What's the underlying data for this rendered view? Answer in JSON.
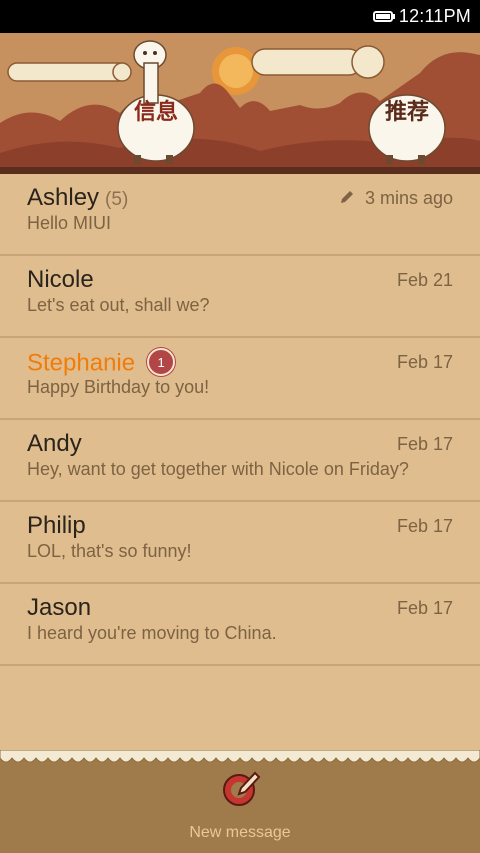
{
  "status_bar": {
    "time": "12:11PM"
  },
  "header": {
    "tab_messages": "信息",
    "tab_recommend": "推荐"
  },
  "conversations": [
    {
      "name": "Ashley",
      "count": "(5)",
      "preview": "Hello MIUI",
      "date": "3 mins ago",
      "draft": true,
      "unread": false,
      "badge": ""
    },
    {
      "name": "Nicole",
      "count": "",
      "preview": "Let's eat out, shall we?",
      "date": "Feb 21",
      "draft": false,
      "unread": false,
      "badge": ""
    },
    {
      "name": "Stephanie",
      "count": "",
      "preview": "Happy Birthday to you!",
      "date": "Feb 17",
      "draft": false,
      "unread": true,
      "badge": "1"
    },
    {
      "name": "Andy",
      "count": "",
      "preview": "Hey, want to get together with Nicole on Friday?",
      "date": "Feb 17",
      "draft": false,
      "unread": false,
      "badge": ""
    },
    {
      "name": "Philip",
      "count": "",
      "preview": "LOL, that's so funny!",
      "date": "Feb 17",
      "draft": false,
      "unread": false,
      "badge": ""
    },
    {
      "name": "Jason",
      "count": "",
      "preview": "I heard you're moving to China.",
      "date": "Feb 17",
      "draft": false,
      "unread": false,
      "badge": ""
    }
  ],
  "footer": {
    "new_message_label": "New message"
  },
  "colors": {
    "unread_name": "#f07d0a",
    "badge": "#b24646",
    "background": "#dfbd8e"
  }
}
